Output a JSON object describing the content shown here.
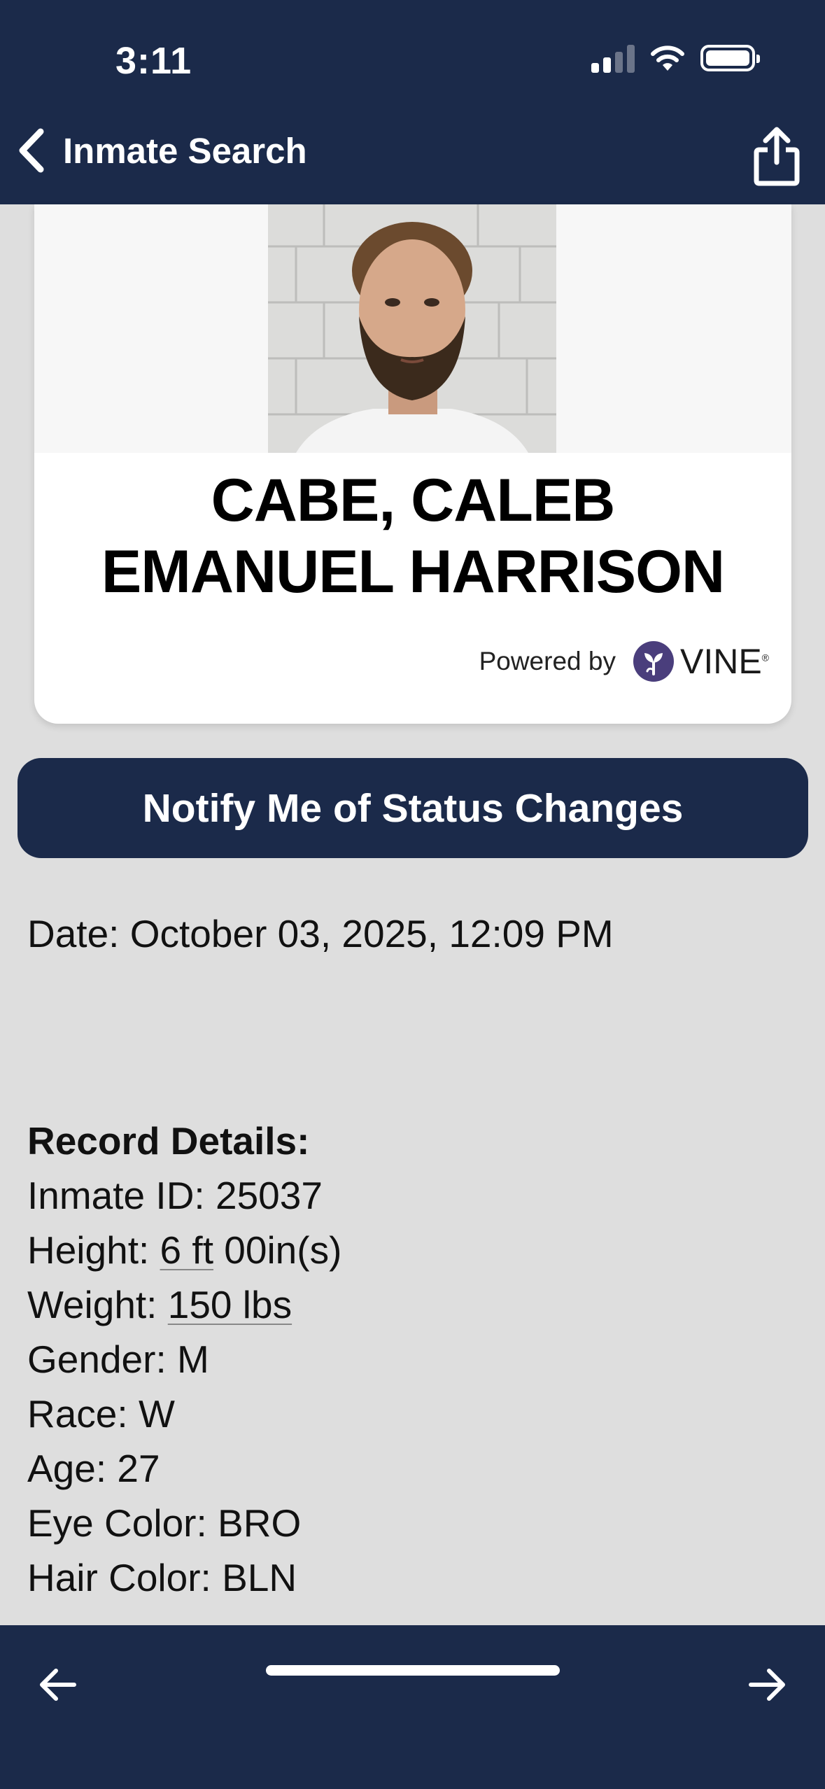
{
  "status_bar": {
    "time": "3:11"
  },
  "nav": {
    "back_label": "Inmate Search"
  },
  "profile": {
    "name_line1": "CABE, CALEB",
    "name_line2": "EMANUEL HARRISON",
    "powered_by": "Powered by",
    "brand": "VINE",
    "brand_mark": "®"
  },
  "notify": {
    "label": "Notify Me of Status Changes"
  },
  "details": {
    "date": "Date: October 03, 2025, 12:09 PM",
    "record_title": "Record Details:",
    "inmate_id": "Inmate ID: 25037",
    "height_label": "Height: ",
    "height_value": "6 ft",
    "height_rest": " 00in(s)",
    "weight_label": "Weight: ",
    "weight_value": "150 lbs",
    "gender": "Gender: M",
    "race": "Race: W",
    "age": "Age: 27",
    "eye_color": "Eye Color: BRO",
    "hair_color": "Hair Color: BLN"
  },
  "icons": {
    "back": "chevron-left-icon",
    "share": "share-icon",
    "prev": "arrow-left-icon",
    "next": "arrow-right-icon"
  },
  "colors": {
    "navy": "#1b2a4a",
    "background": "#dedede",
    "vine_purple": "#4a3e7c"
  }
}
